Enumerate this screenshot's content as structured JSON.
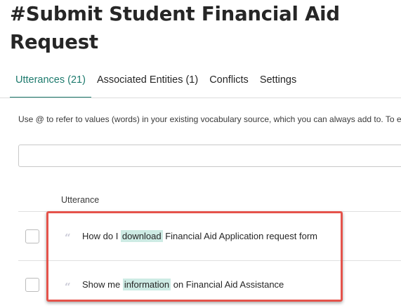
{
  "header": {
    "title": "#Submit Student Financial Aid Request"
  },
  "tabs": [
    {
      "label": "Utterances (21)",
      "active": true
    },
    {
      "label": "Associated Entities (1)",
      "active": false
    },
    {
      "label": "Conflicts",
      "active": false
    },
    {
      "label": "Settings",
      "active": false
    }
  ],
  "hint": "Use @ to refer to values (words) in your existing vocabulary source, which you can always add to. To e",
  "search": {
    "value": ""
  },
  "table": {
    "column_header": "Utterance",
    "rows": [
      {
        "before": "How do I ",
        "highlight": "download",
        "after": " Financial Aid Application request form"
      },
      {
        "before": "Show me ",
        "highlight": "information",
        "after": " on Financial Aid Assistance"
      }
    ]
  },
  "colors": {
    "accent": "#1d7a6d",
    "highlight": "#cdebe4",
    "callout": "#e5534b"
  },
  "icons": [
    "quote-icon"
  ]
}
